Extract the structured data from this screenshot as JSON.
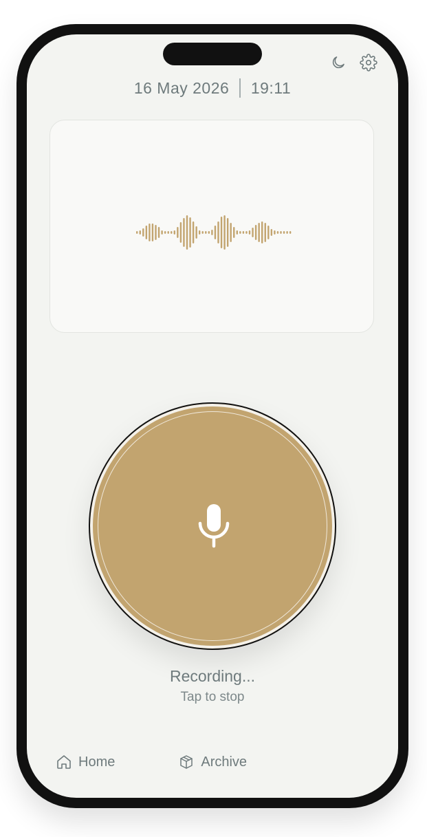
{
  "header": {
    "date": "16 May 2026",
    "time": "19:11",
    "icons": [
      "moon-icon",
      "gear-icon"
    ]
  },
  "waveform": {
    "color": "#c2a46f",
    "levels": [
      2,
      3,
      6,
      10,
      13,
      13,
      11,
      8,
      3,
      2,
      2,
      2,
      3,
      8,
      15,
      21,
      25,
      22,
      16,
      9,
      3,
      2,
      2,
      2,
      4,
      10,
      16,
      23,
      25,
      21,
      14,
      8,
      3,
      2,
      2,
      2,
      3,
      7,
      11,
      14,
      16,
      14,
      10,
      5,
      3,
      2,
      2,
      2,
      2,
      2
    ]
  },
  "record": {
    "color": "#c2a46f",
    "icon": "microphone-icon"
  },
  "status": {
    "label": "Recording...",
    "hint": "Tap to stop"
  },
  "nav": {
    "home_label": "Home",
    "archive_label": "Archive",
    "icons": [
      "home-icon",
      "archive-icon"
    ]
  },
  "colors": {
    "accent": "#c2a46f",
    "text": "#6e7a7c",
    "background": "#f3f4f1"
  }
}
